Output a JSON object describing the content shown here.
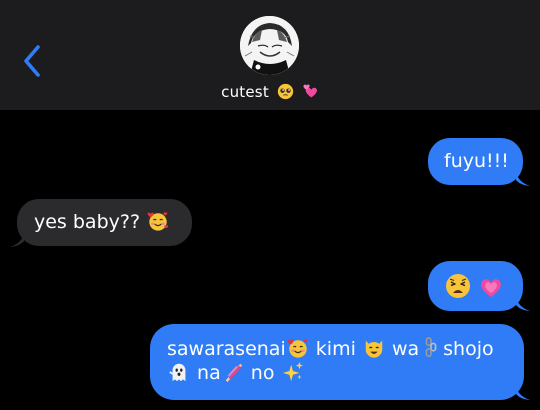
{
  "header": {
    "back_icon": "chevron-left-icon",
    "contact_name": "cutest",
    "name_emojis": [
      "pleading-face-emoji",
      "two-hearts-emoji"
    ]
  },
  "colors": {
    "background": "#000000",
    "header": "#1c1c1e",
    "sent_bubble": "#2f7cf6",
    "received_bubble": "#2b2b2d",
    "accent": "#2f7cf6",
    "text": "#ffffff"
  },
  "messages": [
    {
      "direction": "sent",
      "text": "fuyu!!!"
    },
    {
      "direction": "received",
      "text": "yes baby??",
      "emojis": [
        "smiling-face-with-hearts-emoji"
      ]
    },
    {
      "direction": "sent",
      "text": "",
      "emojis": [
        "weary-face-emoji",
        "growing-heart-emoji"
      ]
    },
    {
      "direction": "sent",
      "line1": {
        "w1": "sawarasenai",
        "w2": "kimi",
        "w3": "wa",
        "w4": "shojo"
      },
      "line2": {
        "w1": "na",
        "w2": "no"
      },
      "emojis": [
        "smiling-face-with-hearts-emoji",
        "grinning-cat-emoji",
        "chains-emoji",
        "ghost-emoji",
        "nail-polish-emoji",
        "sparkles-emoji"
      ]
    }
  ]
}
